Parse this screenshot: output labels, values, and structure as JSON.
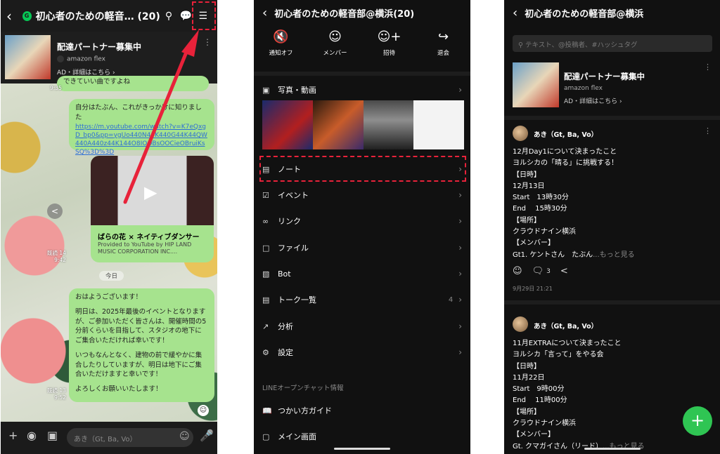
{
  "chat_screen": {
    "back_icon": "chevron-left-icon",
    "group_badge": "G",
    "title": "初心者のための軽音…",
    "member_count": "(20)",
    "ad": {
      "title": "配達パートナー募集中",
      "brand": "amazon flex",
      "link": "AD・詳細はこちら ›",
      "more": "⋮"
    },
    "partial_message": "できていい曲ですよね",
    "partial_time": "9:35",
    "message1_text": "自分はたぶん、これがきっかけに知りました",
    "message1_url": "https://m.youtube.com/watch?v=K7eQxgD_bp0&pp=ygUo440N44K440G44K44QW440A440z44K144O8IOOBsOOCieOBruiKsSQ%3D%3D",
    "video_title": "ばらの花 × ネイティブダンサー",
    "video_source": "Provided to YouTube by HIP LAND MUSIC CORPORATION INC....",
    "read_mark1": "既読 14",
    "time1": "9:42",
    "day_label": "今日",
    "message2": [
      "おはようございます！",
      "明日は、2025年最後のイベントとなりますが、ご参加いただく皆さんは、開催時間の5分前くらいを目指して、スタジオの地下にご集合いただければ幸いです！",
      "いつもなんとなく、建物の前で緩やかに集合したりしていますが、明日は地下にご集合いただけますと幸いです！",
      "よろしくお願いいたします！"
    ],
    "read_mark2": "既読 13",
    "time2": "9:52",
    "input_placeholder": "あき（Gt, Ba, Vo）"
  },
  "menu_screen": {
    "title": "初心者のための軽音部@横浜(20)",
    "actions": [
      {
        "icon": "speaker-off-icon",
        "label": "通知オフ"
      },
      {
        "icon": "members-icon",
        "label": "メンバー"
      },
      {
        "icon": "invite-icon",
        "label": "招待"
      },
      {
        "icon": "exit-icon",
        "label": "退会"
      }
    ],
    "items": [
      {
        "icon": "photo-icon",
        "label": "写真・動画",
        "count": ""
      },
      {
        "icon": "note-icon",
        "label": "ノート",
        "count": ""
      },
      {
        "icon": "calendar-icon",
        "label": "イベント",
        "count": ""
      },
      {
        "icon": "link-icon",
        "label": "リンク",
        "count": ""
      },
      {
        "icon": "folder-icon",
        "label": "ファイル",
        "count": ""
      },
      {
        "icon": "bot-icon",
        "label": "Bot",
        "count": ""
      },
      {
        "icon": "list-icon",
        "label": "トーク一覧",
        "count": "4"
      },
      {
        "icon": "chart-icon",
        "label": "分析",
        "count": ""
      },
      {
        "icon": "gear-icon",
        "label": "設定",
        "count": ""
      }
    ],
    "section_label": "LINEオープンチャット情報",
    "info_items": [
      {
        "icon": "book-icon",
        "label": "つかい方ガイド"
      },
      {
        "icon": "home-icon",
        "label": "メイン画面"
      }
    ]
  },
  "notes_screen": {
    "title": "初心者のための軽音部@横浜",
    "search_placeholder": "テキスト、@投稿者、#ハッシュタグ",
    "ad": {
      "title": "配達パートナー募集中",
      "brand": "amazon flex",
      "link": "AD・詳細はこちら ›"
    },
    "post1": {
      "author": "あき（Gt, Ba, Vo）",
      "body": "12月Day1について決まったこと\nヨルシカの「晴る」に挑戦する！\n【日時】\n12月13日\nStart　13時30分\nEnd　 15時30分\n【場所】\nクラウドナイン横浜\n【メンバー】\nGt1. ケントさん　たぶん",
      "more": "...もっと見る",
      "comment_count": "3",
      "date": "9月29日 21:21"
    },
    "post2": {
      "author": "あき（Gt, Ba, Vo）",
      "body": "11月EXTRAについて決まったこと\nヨルシカ「言って」をやる会\n【日時】\n11月22日\nStart　9時00分\nEnd　 11時00分\n【場所】\nクラウドナイン横浜\n【メンバー】\nGt. クマガイさん（リード）",
      "more": "...もっと見る"
    },
    "fab_label": "+"
  },
  "colors": {
    "line_green": "#06c755",
    "bubble_green": "#a6e38e",
    "annotation_red": "#e8223a",
    "dark_bg": "#111111"
  }
}
